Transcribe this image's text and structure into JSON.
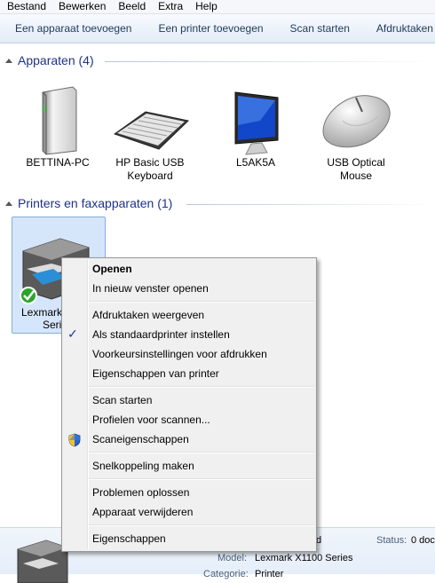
{
  "menubar": [
    "Bestand",
    "Bewerken",
    "Beeld",
    "Extra",
    "Help"
  ],
  "toolbar": [
    "Een apparaat toevoegen",
    "Een printer toevoegen",
    "Scan starten",
    "Afdruktaken w"
  ],
  "devices_group": {
    "title": "Apparaten (4)"
  },
  "devices": [
    {
      "label": "BETTINA-PC",
      "icon": "computer-tower-icon"
    },
    {
      "label": "HP Basic USB Keyboard",
      "icon": "keyboard-icon"
    },
    {
      "label": "L5AK5A",
      "icon": "monitor-icon"
    },
    {
      "label": "USB Optical Mouse",
      "icon": "mouse-icon"
    }
  ],
  "printers_group": {
    "title": "Printers en faxapparaten (1)"
  },
  "printer": {
    "label_line1": "Lexmark",
    "label_line2": "Seri"
  },
  "context_menu": {
    "open": "Openen",
    "open_new_window": "In nieuw venster openen",
    "view_print_jobs": "Afdruktaken weergeven",
    "set_default": "Als standaardprinter instellen",
    "print_prefs": "Voorkeursinstellingen voor afdrukken",
    "printer_props": "Eigenschappen van printer",
    "start_scan": "Scan starten",
    "scan_profiles": "Profielen voor scannen...",
    "scan_props": "Scaneigenschappen",
    "create_shortcut": "Snelkoppeling maken",
    "troubleshoot": "Problemen oplossen",
    "remove_device": "Apparaat verwijderen",
    "properties": "Eigenschappen",
    "checkmark": "✓"
  },
  "details": {
    "name_tail": "d",
    "status_label": "Status:",
    "status_value": "0 doc",
    "model_label": "Model:",
    "model_value": "Lexmark X1100 Series",
    "category_label": "Categorie:",
    "category_value": "Printer"
  }
}
